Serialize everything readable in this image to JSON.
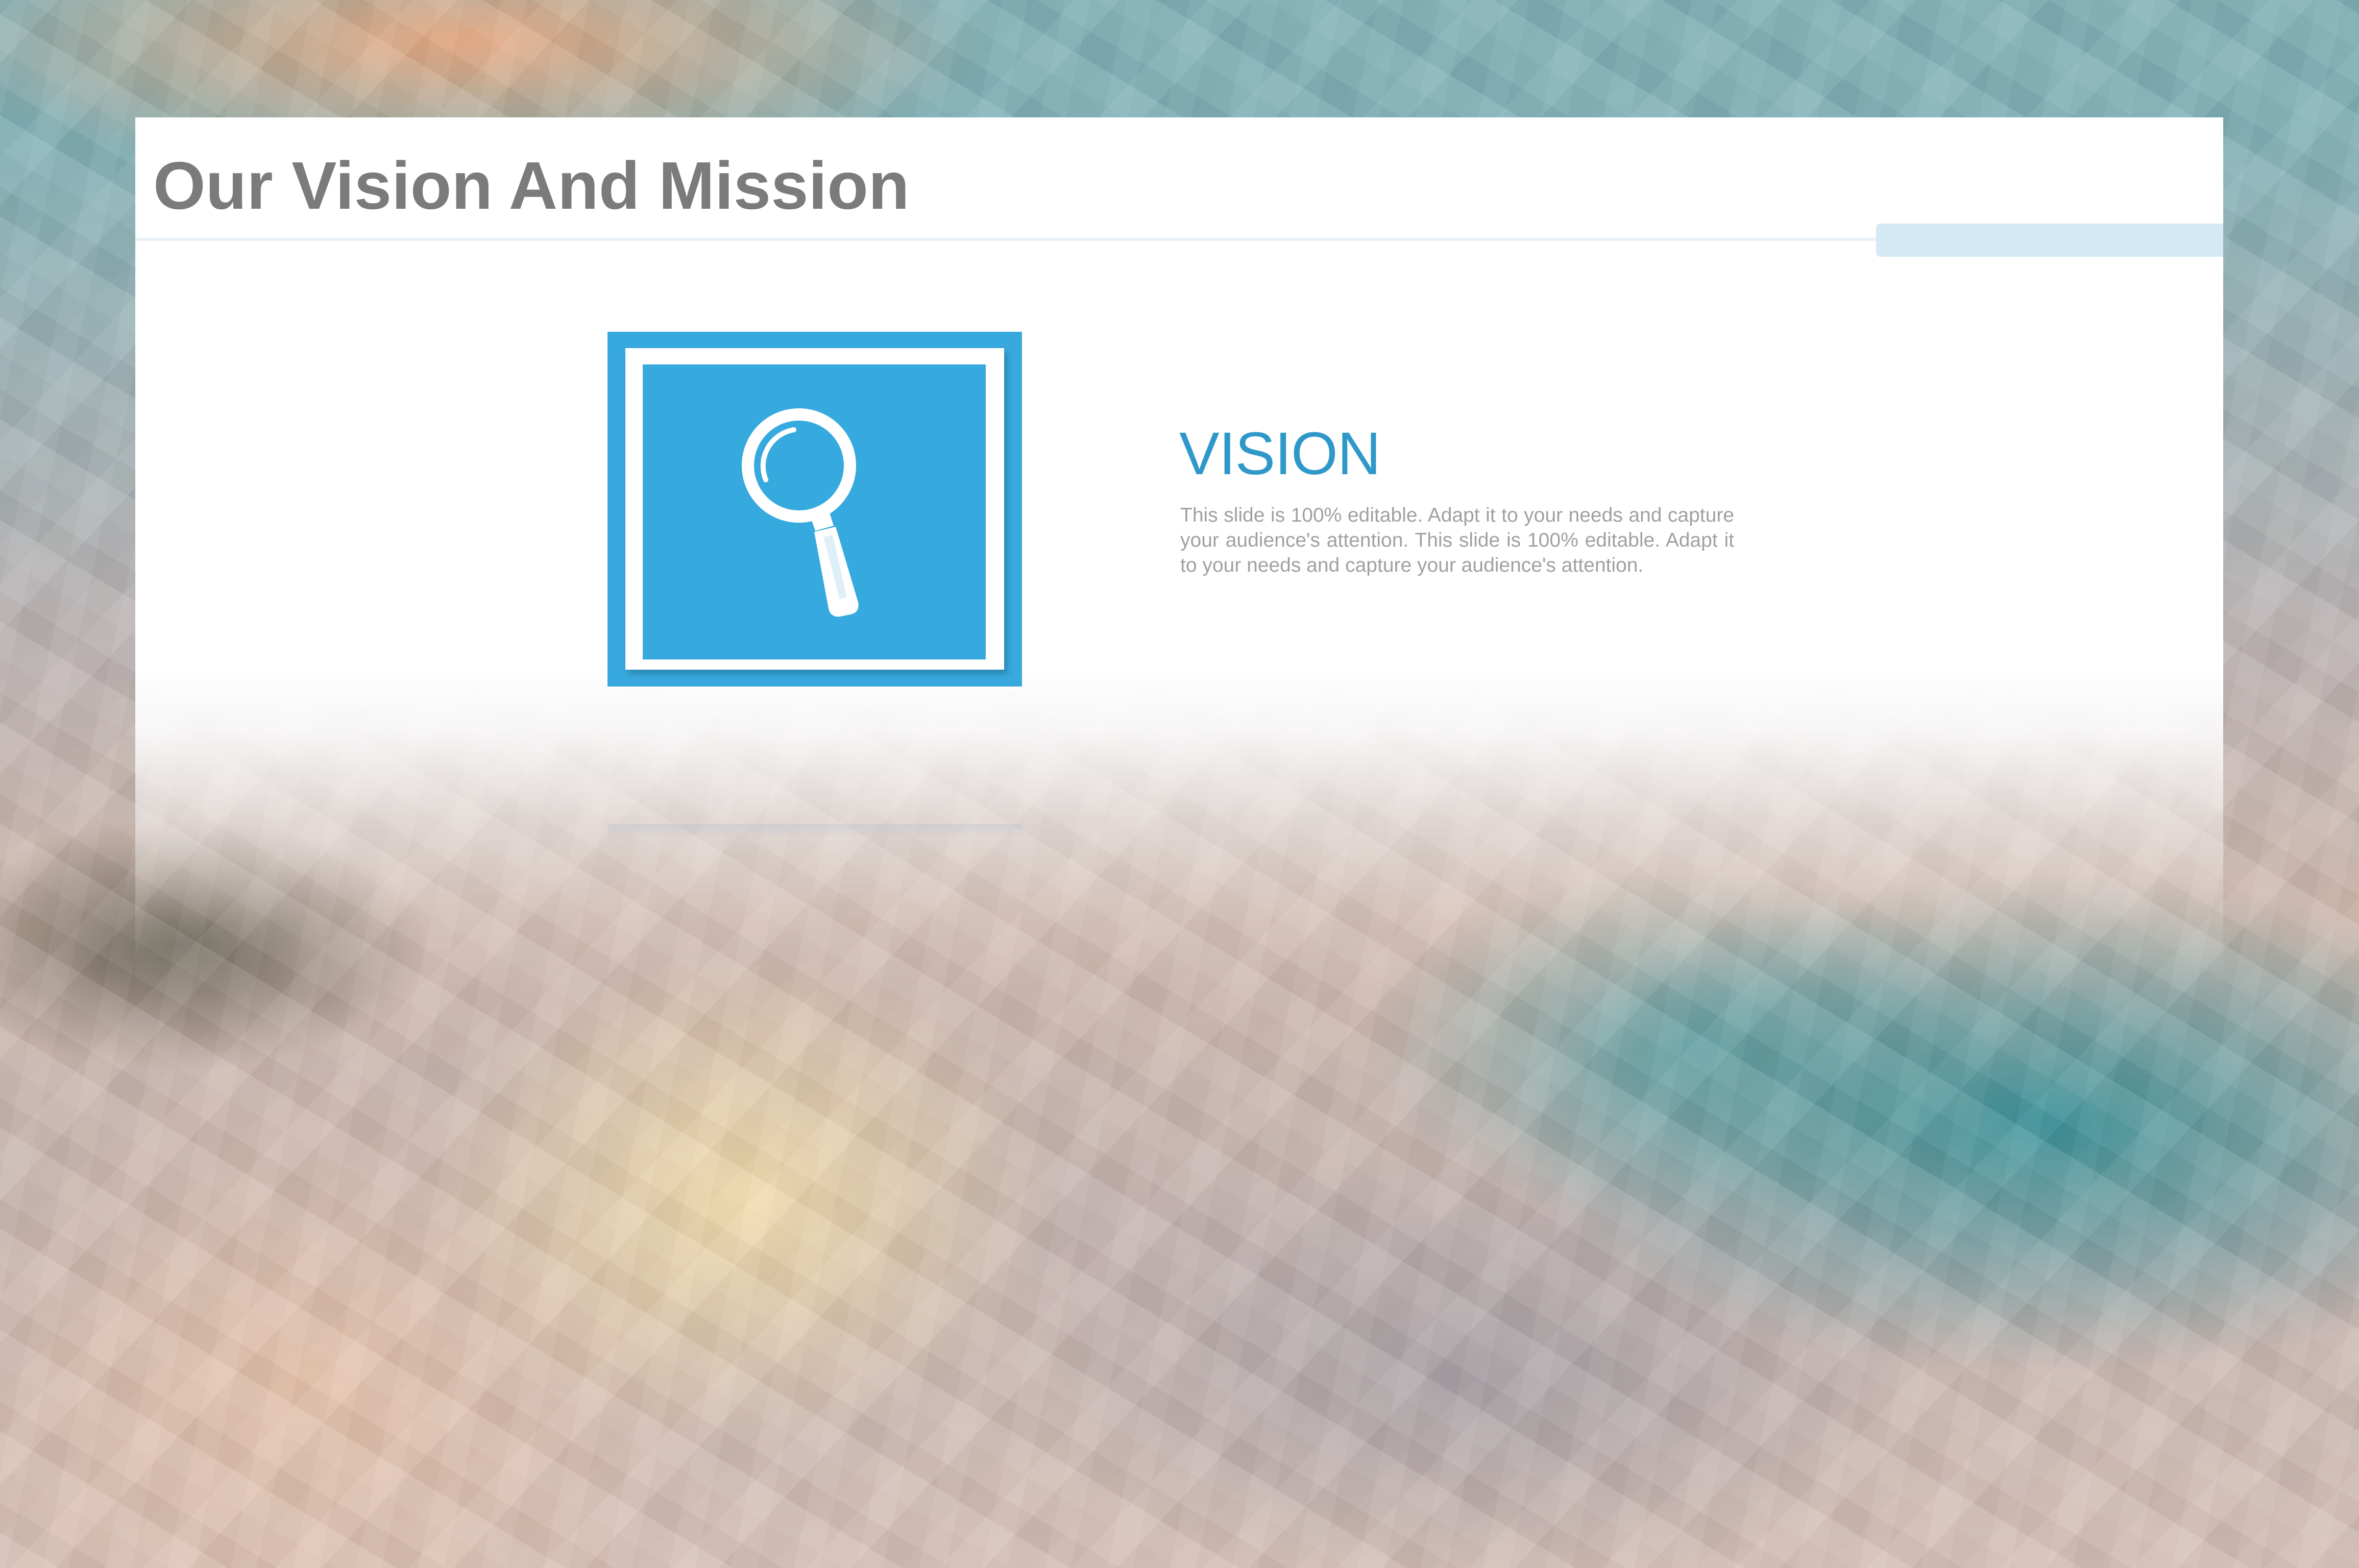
{
  "slide": {
    "title": "Our Vision And Mission"
  },
  "vision": {
    "heading": "VISION",
    "body": "This slide is 100% editable. Adapt it to your needs and capture your audience's attention. This slide is 100% editable. Adapt it to your needs and capture your audience's attention.",
    "icon": "magnifier-icon"
  },
  "colors": {
    "accent_blue": "#36aadf",
    "heading_blue": "#2e98c9",
    "title_gray": "#7b7b7b",
    "body_gray": "#a0a0a0"
  }
}
